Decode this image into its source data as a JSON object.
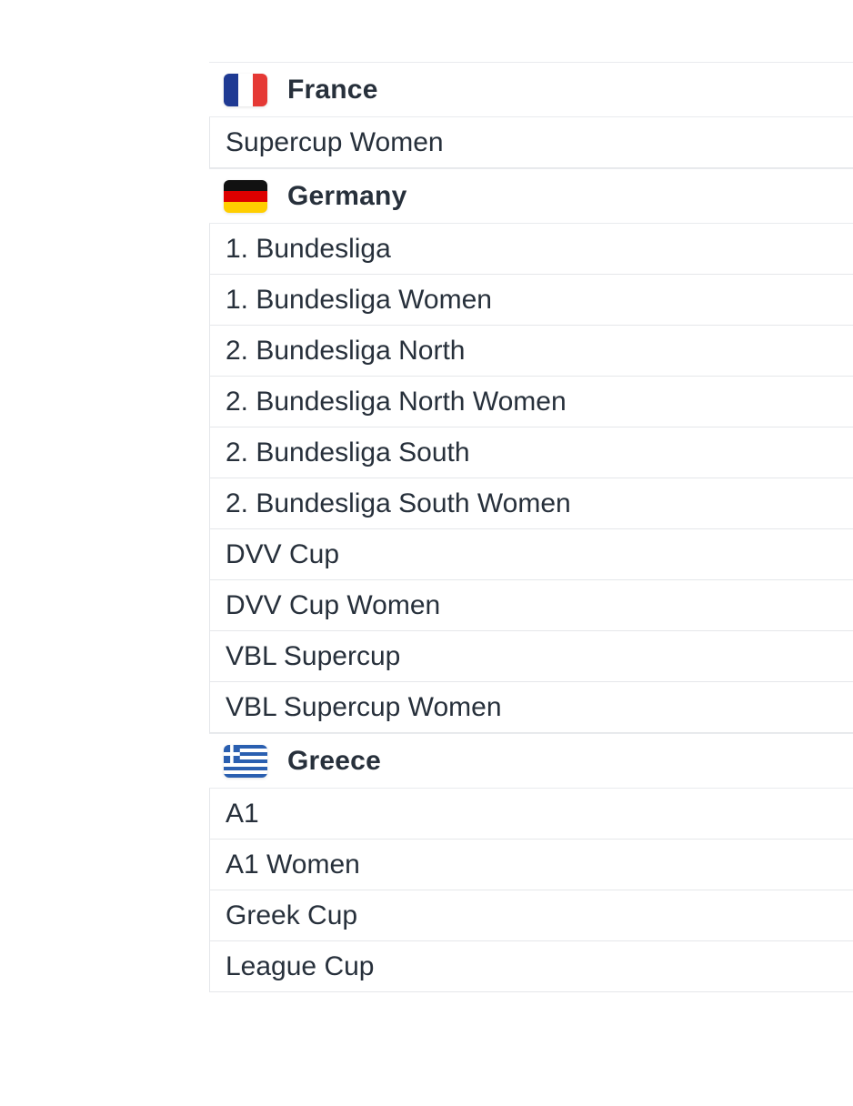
{
  "groups": [
    {
      "country": "France",
      "flag_icon": "france-flag-icon",
      "leagues": [
        "Supercup Women"
      ]
    },
    {
      "country": "Germany",
      "flag_icon": "germany-flag-icon",
      "leagues": [
        "1. Bundesliga",
        "1. Bundesliga Women",
        "2. Bundesliga North",
        "2. Bundesliga North Women",
        "2. Bundesliga South",
        "2. Bundesliga South Women",
        "DVV Cup",
        "DVV Cup Women",
        "VBL Supercup",
        "VBL Supercup Women"
      ]
    },
    {
      "country": "Greece",
      "flag_icon": "greece-flag-icon",
      "leagues": [
        "A1",
        "A1 Women",
        "Greek Cup",
        "League Cup"
      ]
    }
  ],
  "colors": {
    "text": "#27303b",
    "border": "#e5e7ea",
    "france_blue": "#1f3a93",
    "france_red": "#e53935",
    "germany_black": "#111111",
    "germany_red": "#dd0000",
    "germany_gold": "#ffce00",
    "greece_blue": "#2a5fb0"
  }
}
